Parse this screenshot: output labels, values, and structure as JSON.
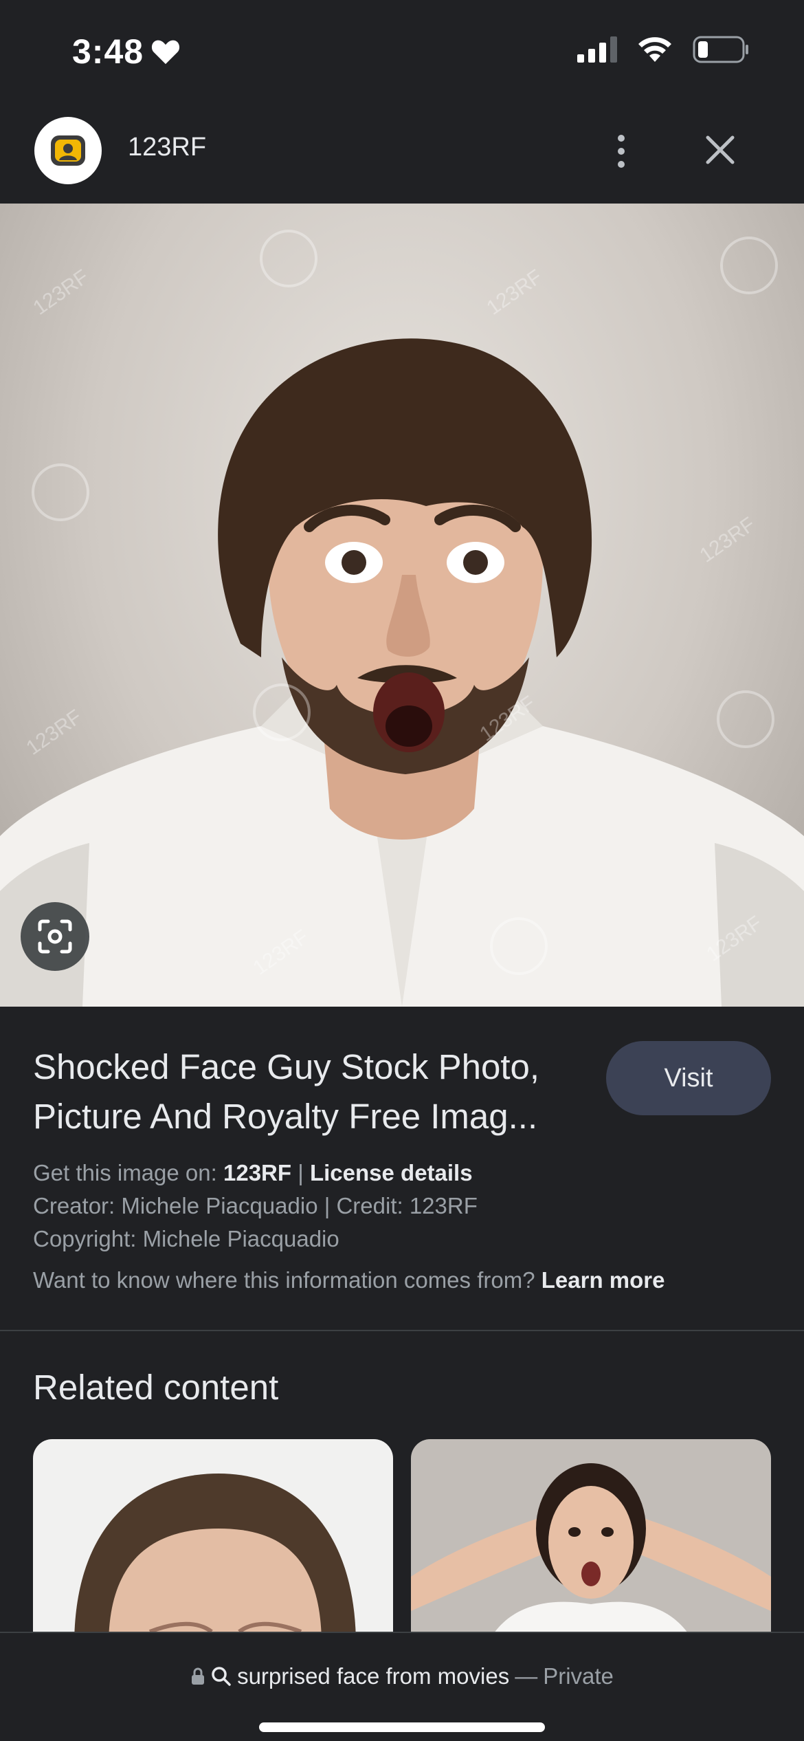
{
  "status_bar": {
    "time": "3:48"
  },
  "header": {
    "site_name": "123RF"
  },
  "image": {
    "watermark": "123RF"
  },
  "info": {
    "title": "Shocked Face Guy Stock Photo, Picture And Royalty Free Imag...",
    "visit_label": "Visit",
    "get_image_prefix": "Get this image on:",
    "get_image_site": "123RF",
    "separator": "|",
    "license_label": "License details",
    "creator_line": "Creator: Michele Piacquadio | Credit: 123RF",
    "copyright_line": "Copyright: Michele Piacquadio",
    "info_question": "Want to know where this information comes from?",
    "learn_more": "Learn more"
  },
  "related": {
    "title": "Related content"
  },
  "bottom_bar": {
    "query": "surprised face from movies",
    "dash": "—",
    "private_label": "Private"
  }
}
